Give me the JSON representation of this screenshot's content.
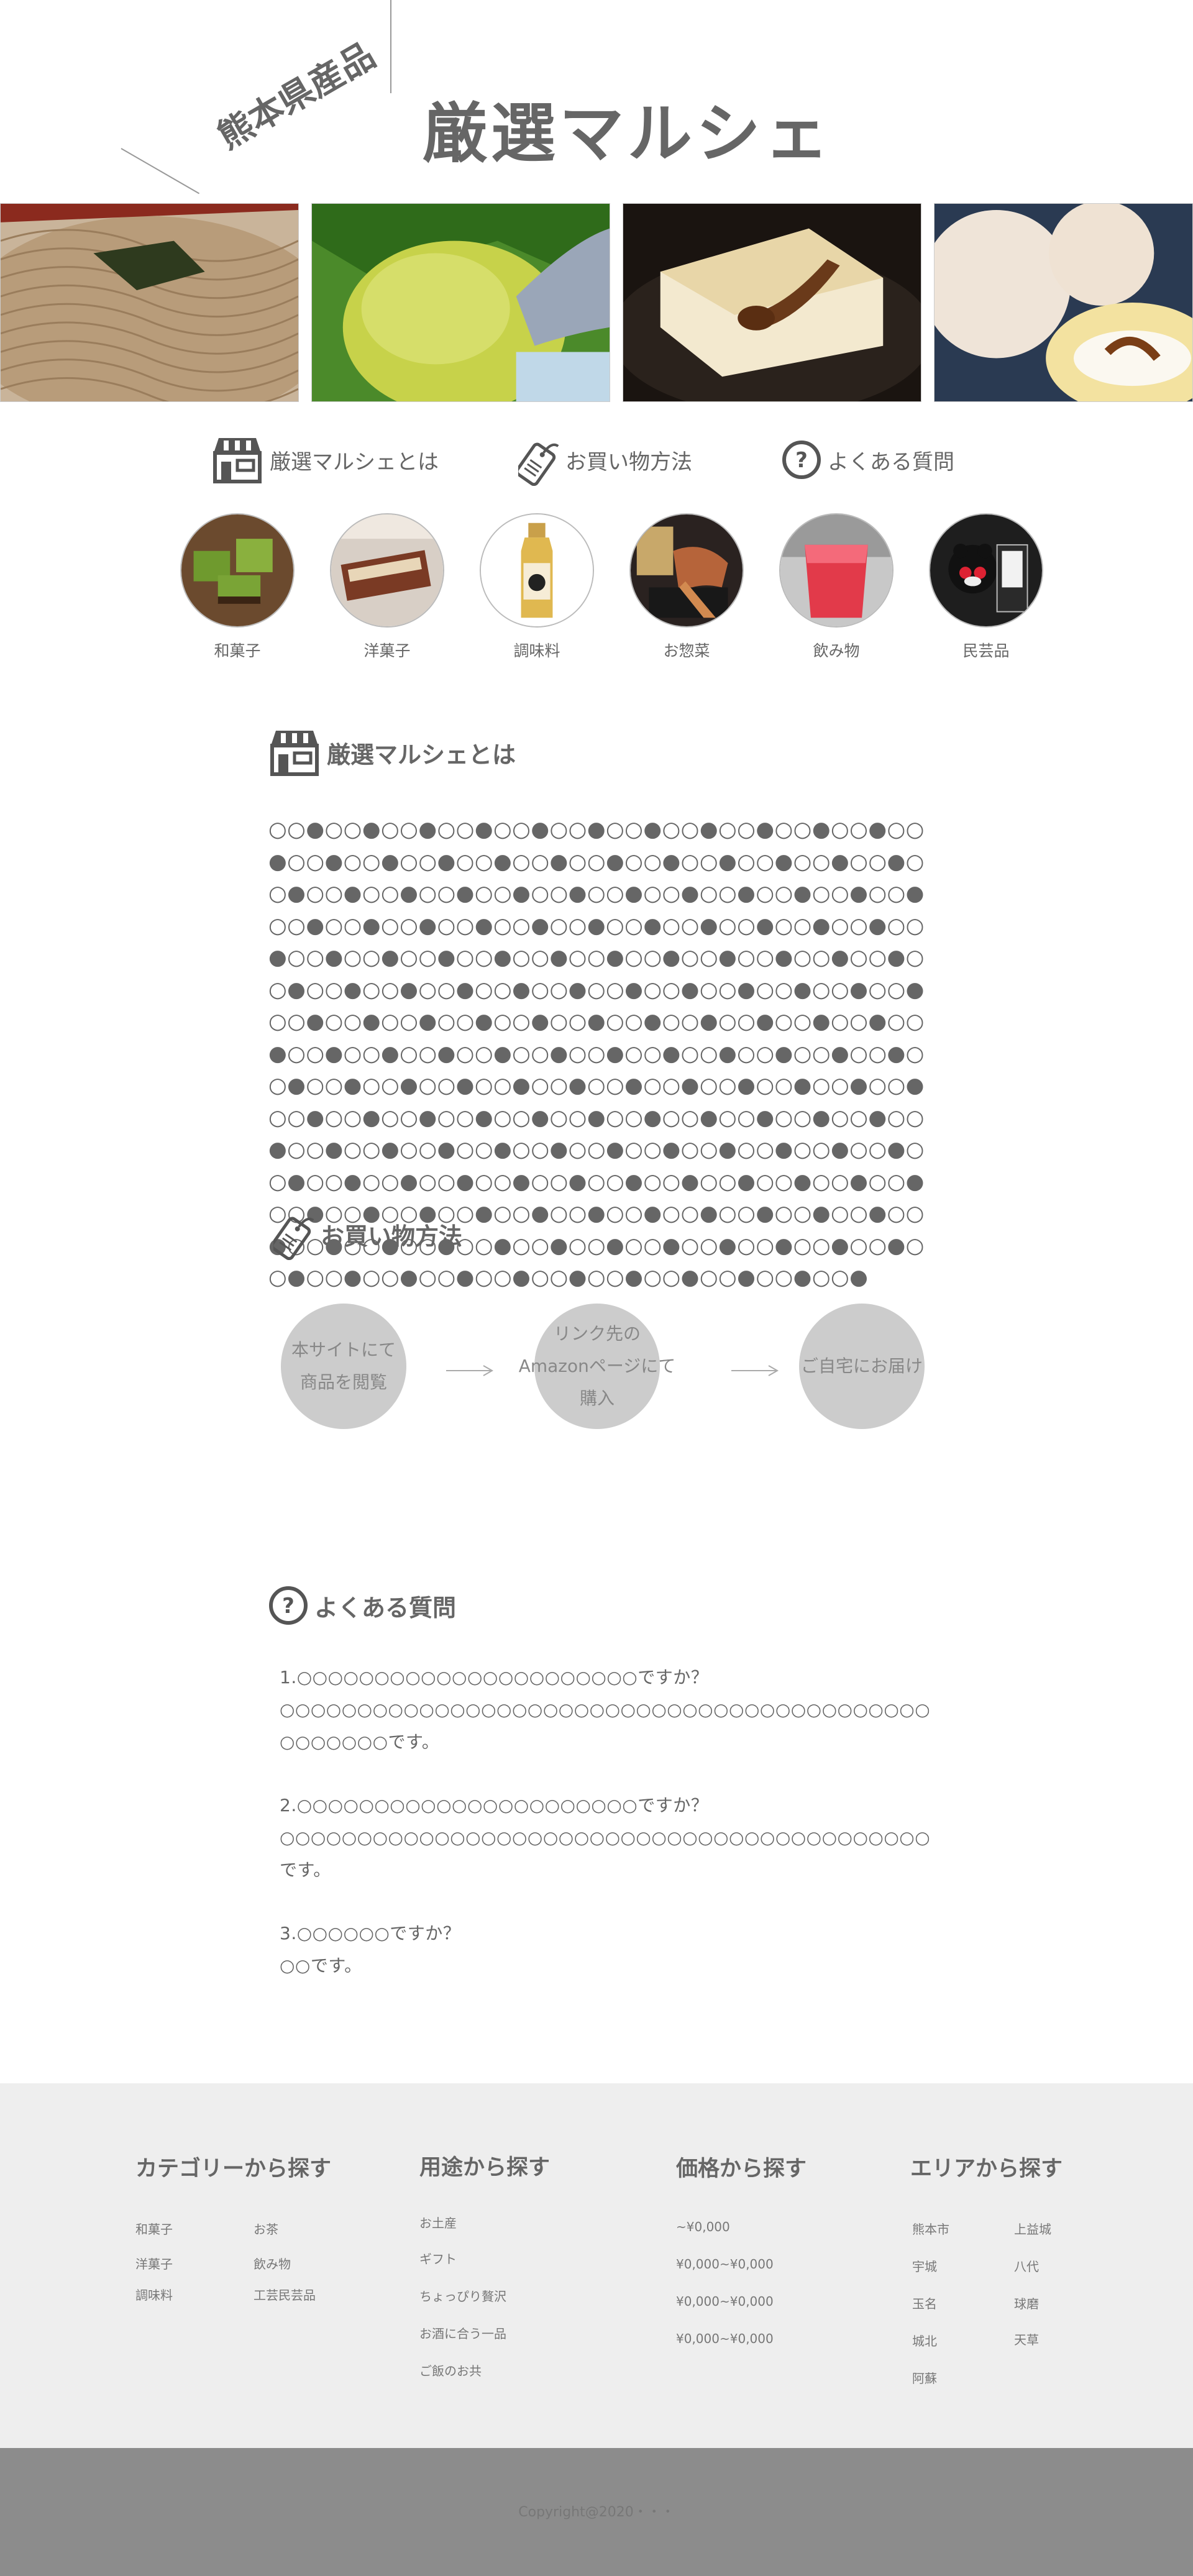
{
  "header": {
    "title": "厳選マルシェ",
    "subtitle": "熊本県産品"
  },
  "photos": [
    {
      "name": "soba-photo",
      "icon": "soba-noodles"
    },
    {
      "name": "matcha-icecream-photo",
      "icon": "matcha-ice-cream"
    },
    {
      "name": "tofu-pudding-photo",
      "icon": "pudding-with-syrup"
    },
    {
      "name": "cream-bun-photo",
      "icon": "cream-bun"
    }
  ],
  "topnav": {
    "about": "厳選マルシェとは",
    "howto": "お買い物方法",
    "faq": "よくある質問"
  },
  "categories": [
    {
      "label": "和菓子",
      "icon": "matcha-cake"
    },
    {
      "label": "洋菓子",
      "icon": "roll-cake"
    },
    {
      "label": "調味料",
      "icon": "sauce-bottle"
    },
    {
      "label": "お惣菜",
      "icon": "side-dish"
    },
    {
      "label": "飲み物",
      "icon": "red-drink"
    },
    {
      "label": "民芸品",
      "icon": "kumamon-figure"
    }
  ],
  "about": {
    "heading": "厳選マルシェとは",
    "text": "○○●○○●○○●○○●○○●○○●○○●○○●○○●○○●○○●○○●○○●○○●○○●○○●○○●○○●○○●○○●○○●○○●○○●○○●○○●○○●○○●○○●○○●○○●○○●○○●○○●○○●○○●○○●○○●○○●○○●○○●○○●○○●○○●○○●○○●○○●○○●○○●○○●○○●○○●○○●○○●○○●○○●○○●○○●○○●○○●○○●○○●○○●○○●○○●○○●○○●○○●○○●○○●○○●○○●○○●○○●○○●○○●○○●○○●○○●○○●○○●○○●○○●○○●○○●○○●○○●○○●○○●○○●○○●○○●○○●○○●○○●○○●○○●○○●○○●○○●○○●○○●○○●○○●○○●○○●○○●○○●○○●○○●○○●○○●○○●○○●○○●○○●○○●○○●○○●○○●○○●○○●○○●○○●○○●○○●○○●○○●○○●○○●○○●○○●○○●○○●○○●○○●○○●○○●○○●○○●○○●○○●○○●○○●○○●○○●○○●○○●○○●○○●○○●○○●○○●○○●○○●○○●○○●○○●○○●○○●○○●○○●○○●○○●○○●○○●○○●○○●○○●○○●○○●○○●○○●○○●○○●"
  },
  "howto": {
    "heading": "お買い物方法",
    "steps": [
      [
        "本サイトにて",
        "商品を閲覧"
      ],
      [
        "リンク先の",
        "Amazonページにて",
        "購入"
      ],
      [
        "ご自宅にお届け"
      ]
    ]
  },
  "faq": {
    "heading": "よくある質問",
    "items": [
      {
        "q": "1.○○○○○○○○○○○○○○○○○○○○○○ですか？",
        "a": "○○○○○○○○○○○○○○○○○○○○○○○○○○○○○○○○○○○○○○○○○○○○○○○○○です。"
      },
      {
        "q": "2.○○○○○○○○○○○○○○○○○○○○○○ですか？",
        "a": "○○○○○○○○○○○○○○○○○○○○○○○○○○○○○○○○○○○○○○○○○○です。"
      },
      {
        "q": "3.○○○○○○ですか？",
        "a": "○○です。"
      }
    ]
  },
  "footer": {
    "category": {
      "heading": "カテゴリーから探す",
      "col1": [
        "和菓子",
        "洋菓子",
        "調味料"
      ],
      "col2": [
        "お茶",
        "飲み物",
        "工芸民芸品"
      ]
    },
    "purpose": {
      "heading": "用途から探す",
      "items": [
        "お土産",
        "ギフト",
        "ちょっぴり贅沢",
        "お酒に合う一品",
        "ご飯のお共"
      ]
    },
    "price": {
      "heading": "価格から探す",
      "items": [
        "~¥0,000",
        "¥0,000~¥0,000",
        "¥0,000~¥0,000",
        "¥0,000~¥0,000"
      ]
    },
    "area": {
      "heading": "エリアから探す",
      "col1": [
        "熊本市",
        "宇城",
        "玉名",
        "城北",
        "阿蘇"
      ],
      "col2": [
        "上益城",
        "八代",
        "球磨",
        "天草"
      ]
    },
    "copyright": "Copyright@2020・・・"
  },
  "colors": {
    "text": "#666666",
    "footer_bg": "#eeeeee",
    "copyright_bg": "#8c8c8c",
    "step_circle": "#cccccc"
  }
}
